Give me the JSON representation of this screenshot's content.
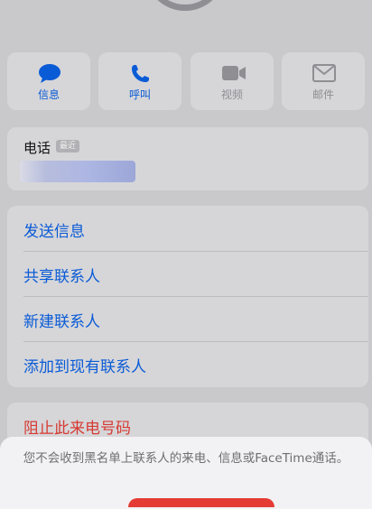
{
  "actions": [
    {
      "label": "信息",
      "icon": "message-icon",
      "enabled": true
    },
    {
      "label": "呼叫",
      "icon": "phone-icon",
      "enabled": true
    },
    {
      "label": "视频",
      "icon": "video-icon",
      "enabled": false
    },
    {
      "label": "邮件",
      "icon": "mail-icon",
      "enabled": false
    }
  ],
  "phone": {
    "title": "电话",
    "badge": "最近"
  },
  "menu": {
    "send_message": "发送信息",
    "share_contact": "共享联系人",
    "new_contact": "新建联系人",
    "add_to_existing": "添加到现有联系人"
  },
  "block": {
    "label": "阻止此来电号码"
  },
  "sheet": {
    "message": "您不会收到黑名单上联系人的来电、信息或FaceTime通话。"
  },
  "colors": {
    "accent": "#0a5bd6",
    "destructive": "#d63a32"
  }
}
